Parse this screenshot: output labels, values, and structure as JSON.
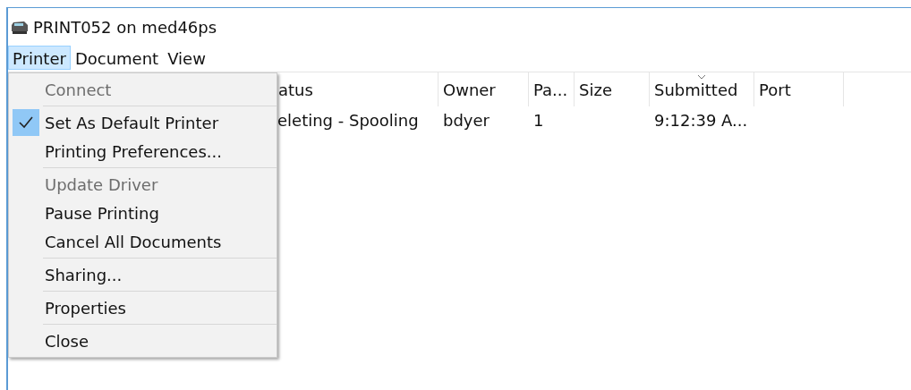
{
  "window": {
    "title": "PRINT052 on med46ps"
  },
  "menubar": [
    {
      "label": "Printer",
      "selected": true
    },
    {
      "label": "Document",
      "selected": false
    },
    {
      "label": "View",
      "selected": false
    }
  ],
  "table": {
    "columns": [
      {
        "label": "atus",
        "sorted": false
      },
      {
        "label": "Owner",
        "sorted": false
      },
      {
        "label": "Pa...",
        "sorted": false
      },
      {
        "label": "Size",
        "sorted": false
      },
      {
        "label": "Submitted",
        "sorted": true
      },
      {
        "label": "Port",
        "sorted": false
      }
    ],
    "rows": [
      [
        "eleting - Spooling",
        "bdyer",
        "1",
        "",
        "9:12:39 A...",
        ""
      ]
    ]
  },
  "menu": {
    "groups": [
      [
        {
          "label": "Connect",
          "disabled": true,
          "checked": false
        }
      ],
      [
        {
          "label": "Set As Default Printer",
          "disabled": false,
          "checked": true
        },
        {
          "label": "Printing Preferences...",
          "disabled": false,
          "checked": false
        }
      ],
      [
        {
          "label": "Update Driver",
          "disabled": true,
          "checked": false
        },
        {
          "label": "Pause Printing",
          "disabled": false,
          "checked": false
        },
        {
          "label": "Cancel All Documents",
          "disabled": false,
          "checked": false
        }
      ],
      [
        {
          "label": "Sharing...",
          "disabled": false,
          "checked": false
        }
      ],
      [
        {
          "label": "Properties",
          "disabled": false,
          "checked": false
        }
      ],
      [
        {
          "label": "Close",
          "disabled": false,
          "checked": false
        }
      ]
    ]
  }
}
